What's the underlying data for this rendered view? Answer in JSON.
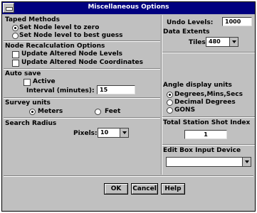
{
  "window": {
    "title": "Miscellaneous Options"
  },
  "target_methods": {
    "heading": "Taped Methods",
    "options": [
      {
        "label": "Set Node level to zero",
        "selected": true
      },
      {
        "label": "Set Node level to best guess",
        "selected": false
      }
    ]
  },
  "node_recalc": {
    "heading": "Node Recalculation Options",
    "options": [
      {
        "label": "Update Altered Node Levels",
        "checked": false
      },
      {
        "label": "Update Altered Node Coordinates",
        "checked": false
      }
    ]
  },
  "autosave": {
    "heading": "Auto save",
    "active_label": "Active",
    "interval_label": "Interval (minutes):",
    "interval_value": "15"
  },
  "survey_units": {
    "heading": "Survey units",
    "options": [
      {
        "label": "Meters",
        "selected": true
      },
      {
        "label": "Feet",
        "selected": false
      }
    ]
  },
  "search_radius": {
    "heading": "Search Radius",
    "pixels_label": "Pixels:",
    "pixels_value": "10"
  },
  "undo": {
    "label": "Undo Levels:",
    "value": "1000"
  },
  "data_extents": {
    "heading": "Data Extents",
    "tiles_label": "Tiles:",
    "tiles_value": "480"
  },
  "angle_units": {
    "heading": "Angle display units",
    "options": [
      {
        "label": "Degrees,Mins,Secs",
        "selected": true
      },
      {
        "label": "Decimal Degrees",
        "selected": false
      },
      {
        "label": "GONS",
        "selected": false
      }
    ]
  },
  "total_station": {
    "heading": "Total Station Shot Index",
    "value": "1"
  },
  "edit_box": {
    "heading": "Edit Box Input Device",
    "value": ""
  },
  "buttons": {
    "ok": "OK",
    "cancel": "Cancel",
    "help": "Help"
  }
}
